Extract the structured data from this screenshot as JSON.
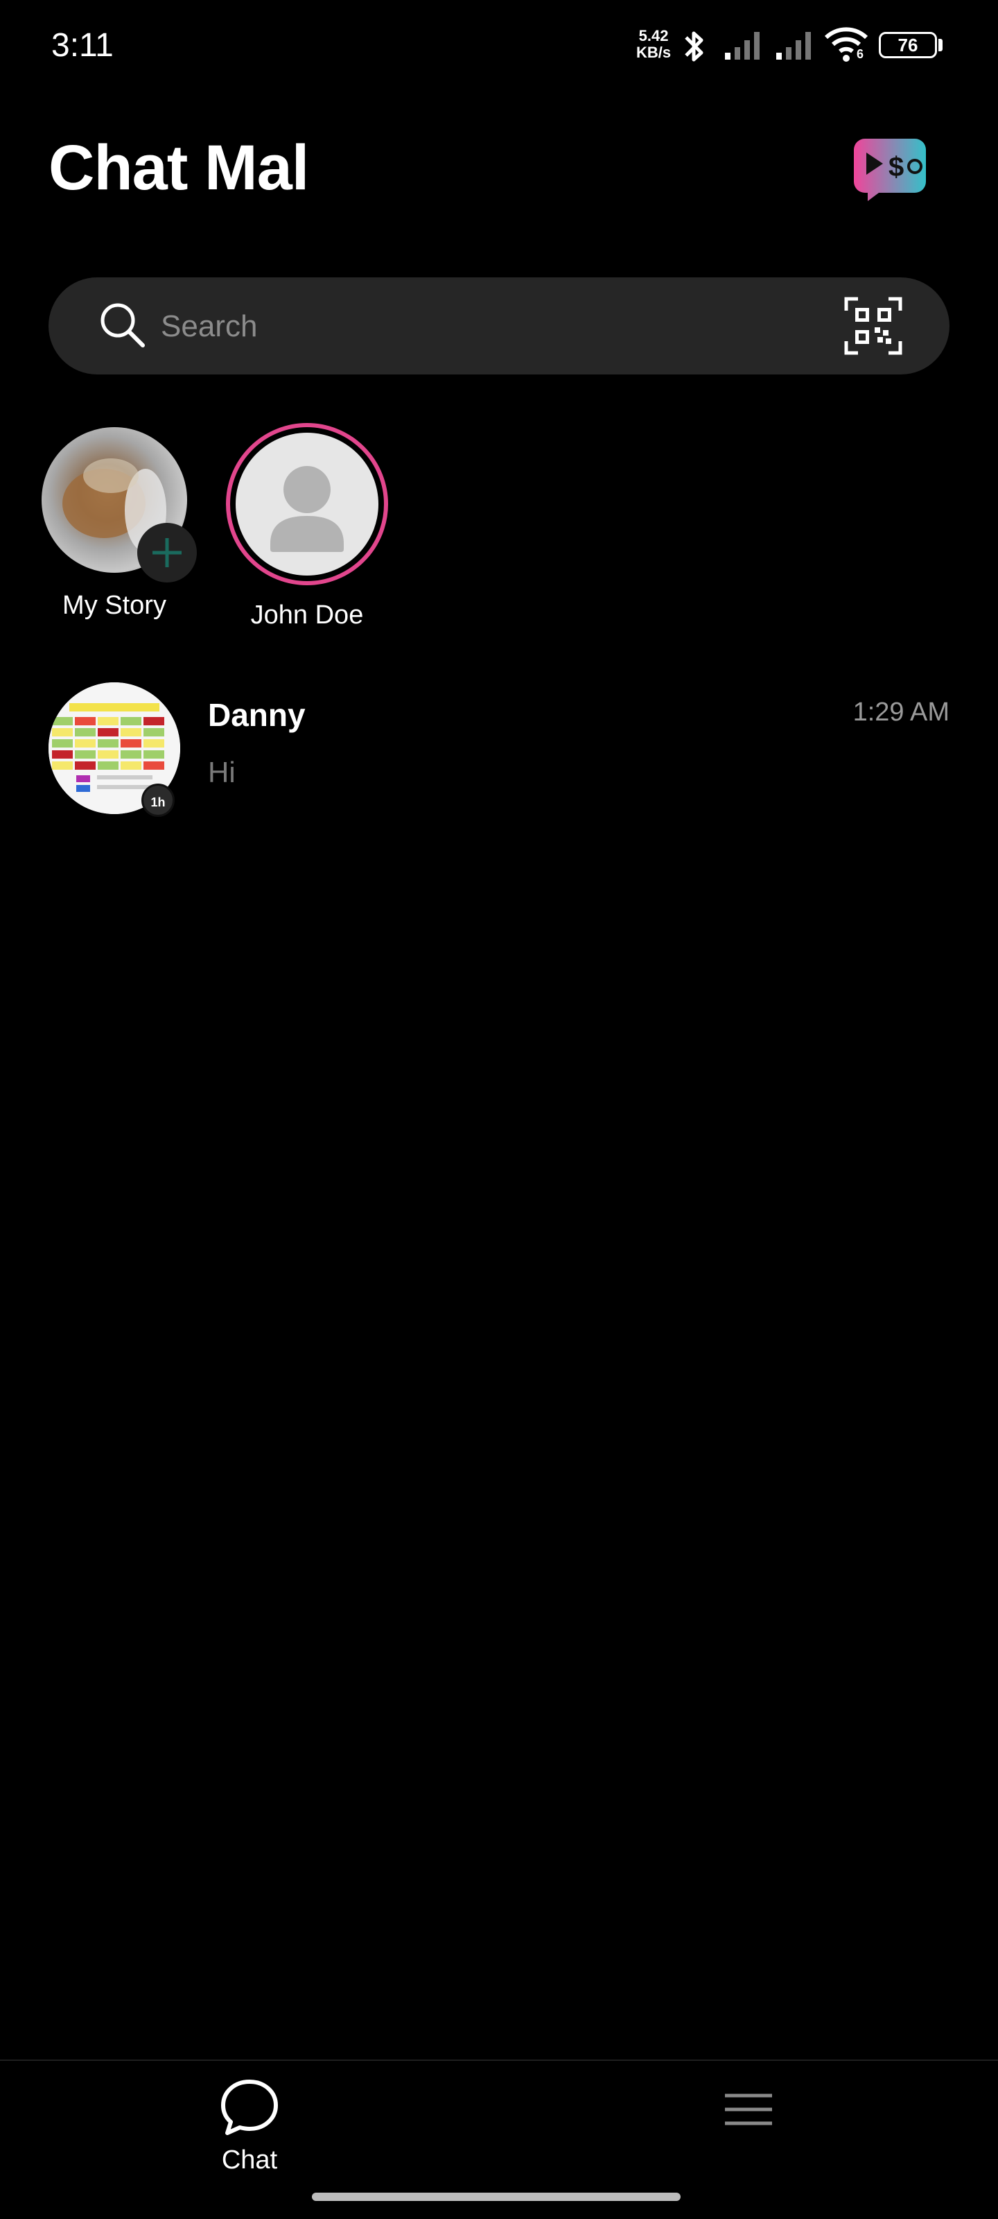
{
  "status_bar": {
    "time": "3:11",
    "net_speed_value": "5.42",
    "net_speed_unit": "KB/s",
    "wifi_label": "6",
    "battery": "76",
    "icons": [
      "bluetooth-icon",
      "signal-icon",
      "signal-icon",
      "wifi-icon"
    ]
  },
  "header": {
    "title": "Chat Mal",
    "promo_icon": "video-money-icon",
    "accent": "#e2468d"
  },
  "search": {
    "placeholder": "Search",
    "value": "",
    "icons": [
      "search-icon",
      "qr-code-icon"
    ]
  },
  "stories": [
    {
      "label": "My Story",
      "badge_icon": "plus-icon"
    },
    {
      "label": "John Doe"
    }
  ],
  "chats": [
    {
      "name": "Danny",
      "last_message": "Hi",
      "time": "1:29 AM",
      "badge": "1h"
    }
  ],
  "bottom_nav": {
    "items": [
      {
        "label": "Chat",
        "icon": "chat-bubble-icon"
      },
      {
        "label": "",
        "icon": "menu-icon"
      }
    ]
  }
}
